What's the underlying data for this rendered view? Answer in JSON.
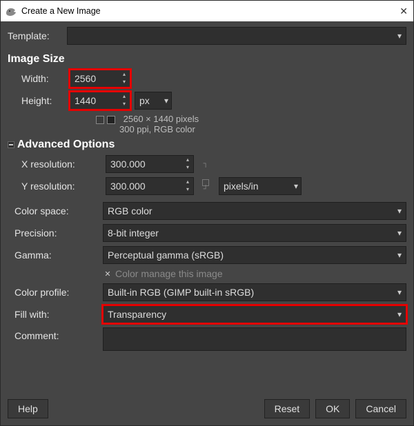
{
  "window": {
    "title": "Create a New Image"
  },
  "template": {
    "label": "Template:",
    "value": ""
  },
  "image_size": {
    "section_title": "Image Size",
    "width_label": "Width:",
    "width_value": "2560",
    "height_label": "Height:",
    "height_value": "1440",
    "unit": "px",
    "dims_text": "2560 × 1440 pixels",
    "ppi_text": "300 ppi, RGB color"
  },
  "advanced": {
    "section_title": "Advanced Options",
    "xres_label": "X resolution:",
    "xres_value": "300.000",
    "yres_label": "Y resolution:",
    "yres_value": "300.000",
    "res_unit": "pixels/in",
    "color_space_label": "Color space:",
    "color_space_value": "RGB color",
    "precision_label": "Precision:",
    "precision_value": "8-bit integer",
    "gamma_label": "Gamma:",
    "gamma_value": "Perceptual gamma (sRGB)",
    "color_manage_label": "Color manage this image",
    "color_profile_label": "Color profile:",
    "color_profile_value": "Built-in RGB (GIMP built-in sRGB)",
    "fill_label": "Fill with:",
    "fill_value": "Transparency",
    "comment_label": "Comment:",
    "comment_value": ""
  },
  "buttons": {
    "help": "Help",
    "reset": "Reset",
    "ok": "OK",
    "cancel": "Cancel"
  }
}
